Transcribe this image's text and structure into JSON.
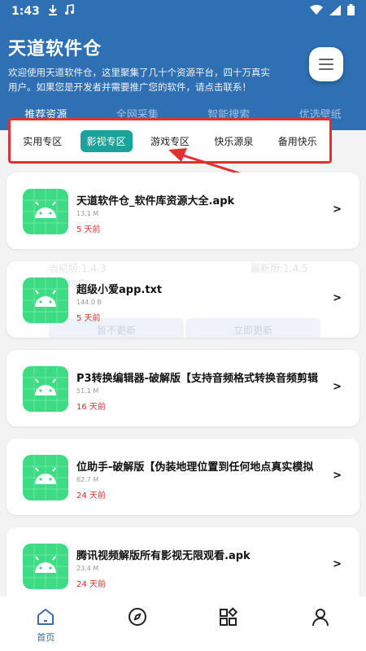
{
  "status_bar": {
    "time": "1:43",
    "icons": [
      "download-icon",
      "music-icon"
    ],
    "right_icons": [
      "wifi-icon",
      "signal-icon",
      "battery-icon"
    ]
  },
  "header": {
    "title": "天道软件仓",
    "description": "欢迎使用天道软件仓，这里聚集了几十个资源平台，四十万真实用户。如果您是开发者并需要推广您的软件，请点击联系！",
    "menu_icon": "menu-icon"
  },
  "main_tabs": [
    {
      "label": "推荐资源",
      "active": true
    },
    {
      "label": "全网采集",
      "active": false
    },
    {
      "label": "智能搜索",
      "active": false
    },
    {
      "label": "优选壁纸",
      "active": false
    }
  ],
  "sub_tabs": [
    {
      "label": "实用专区",
      "active": false
    },
    {
      "label": "影视专区",
      "active": true
    },
    {
      "label": "游戏专区",
      "active": false
    },
    {
      "label": "快乐源泉",
      "active": false
    },
    {
      "label": "备用快乐",
      "active": false
    }
  ],
  "items": [
    {
      "name": "天道软件仓_软件库资源大全.apk",
      "size": "13.1 M",
      "time": "5 天前",
      "icon": "android-icon"
    },
    {
      "name": "超级小爱app.txt",
      "size": "144.0 B",
      "time": "5 天前",
      "icon": "android-icon"
    },
    {
      "name": "P3转换编辑器-破解版【支持音频格式转换音频剪辑",
      "size": "51.1 M",
      "time": "16 天前",
      "icon": "android-icon"
    },
    {
      "name": "位助手-破解版【伪装地理位置到任何地点真实模拟",
      "size": "62.7 M",
      "time": "24 天前",
      "icon": "android-icon"
    },
    {
      "name": "腾讯视频解版所有影视无限观看.apk",
      "size": "23.4 M",
      "time": "24 天前",
      "icon": "android-icon"
    }
  ],
  "chevron": ">",
  "overlay": {
    "current_version": "当前版:1.4.3",
    "latest_version": "最新版:1.4.5",
    "update_content": "更新内容",
    "later_button": "暂不更新",
    "update_button": "立即更新"
  },
  "bottom_nav": [
    {
      "label": "首页",
      "icon": "home-icon",
      "active": true
    },
    {
      "label": "",
      "icon": "compass-icon",
      "active": false
    },
    {
      "label": "",
      "icon": "apps-icon",
      "active": false
    },
    {
      "label": "",
      "icon": "user-icon",
      "active": false
    }
  ],
  "colors": {
    "header_bg": "#2f6fb3",
    "accent_teal": "#1aa39b",
    "highlight_red": "#e03131",
    "android_green": "#3ddc84",
    "nav_blue": "#3a6ba8"
  }
}
